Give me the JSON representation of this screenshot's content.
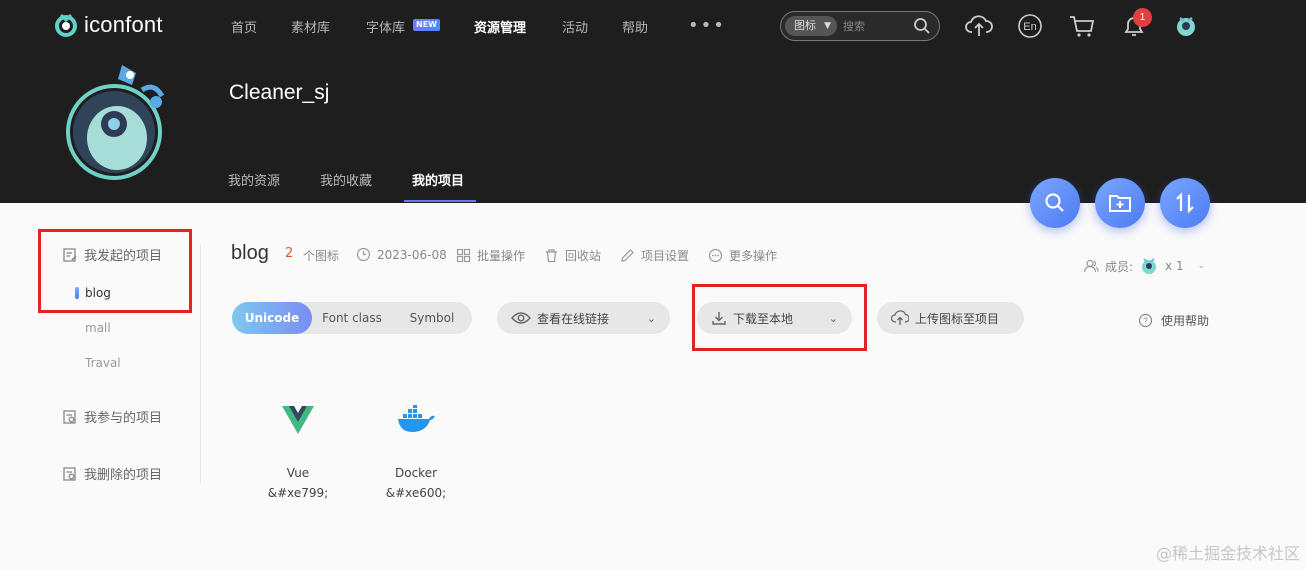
{
  "header": {
    "logo_text": "iconfont",
    "nav": [
      {
        "label": "首页",
        "active": false
      },
      {
        "label": "素材库",
        "active": false
      },
      {
        "label": "字体库",
        "active": false
      },
      {
        "label": "资源管理",
        "active": true
      },
      {
        "label": "活动",
        "active": false
      },
      {
        "label": "帮助",
        "active": false
      }
    ],
    "new_badge": "NEW",
    "more": "•••",
    "search": {
      "type_label": "图标",
      "placeholder": "搜索"
    },
    "notification_count": "1"
  },
  "profile": {
    "username": "Cleaner_sj",
    "tabs": [
      {
        "label": "我的资源",
        "active": false
      },
      {
        "label": "我的收藏",
        "active": false
      },
      {
        "label": "我的项目",
        "active": true
      }
    ]
  },
  "sidebar": {
    "created_heading": "我发起的项目",
    "created_projects": [
      "blog",
      "mall",
      "Traval"
    ],
    "active_project": "blog",
    "joined_heading": "我参与的项目",
    "deleted_heading": "我删除的项目"
  },
  "project": {
    "name": "blog",
    "icon_count": "2",
    "icon_count_unit": "个图标",
    "date": "2023-06-08",
    "actions": [
      "批量操作",
      "回收站",
      "项目设置",
      "更多操作"
    ],
    "members_label": "成员:",
    "members_count": "x 1"
  },
  "toolbar": {
    "modes": [
      "Unicode",
      "Font class",
      "Symbol"
    ],
    "active_mode": "Unicode",
    "view_link": "查看在线链接",
    "download": "下载至本地",
    "upload": "上传图标至项目",
    "help": "使用帮助"
  },
  "icons": [
    {
      "name": "Vue",
      "code": "&#xe799;",
      "icon": "vue-logo"
    },
    {
      "name": "Docker",
      "code": "&#xe600;",
      "icon": "docker-logo"
    }
  ],
  "watermark": "@稀土掘金技术社区",
  "colors": {
    "accent": "#6b74ff",
    "highlight_box": "#e02424",
    "header_bg": "#1e1e1e"
  }
}
